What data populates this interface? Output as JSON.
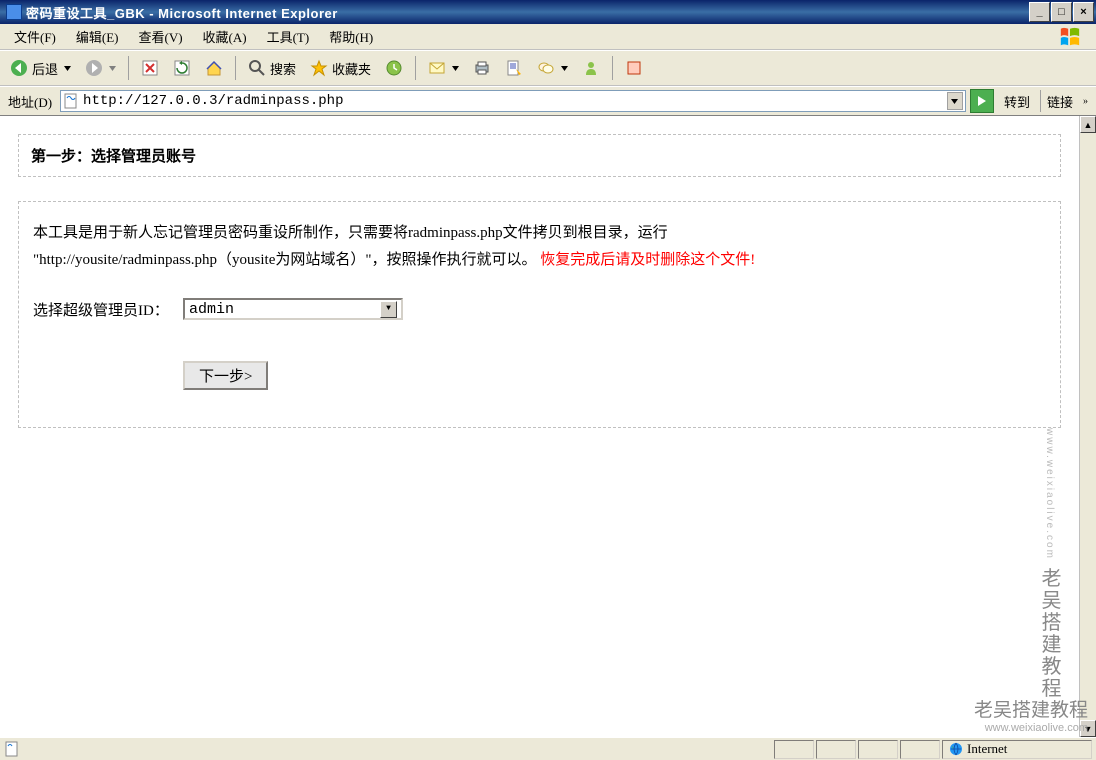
{
  "window": {
    "title": "密码重设工具_GBK - Microsoft Internet Explorer",
    "min": "_",
    "max": "□",
    "close": "×"
  },
  "menu": {
    "file": "文件(F)",
    "edit": "编辑(E)",
    "view": "查看(V)",
    "favorites": "收藏(A)",
    "tools": "工具(T)",
    "help": "帮助(H)"
  },
  "toolbar": {
    "back": "后退",
    "search": "搜索",
    "favorites": "收藏夹"
  },
  "addressbar": {
    "label": "地址(D)",
    "url": "http://127.0.0.3/radminpass.php",
    "go": "转到",
    "links": "链接"
  },
  "page": {
    "step_title": "第一步：选择管理员账号",
    "desc_prefix": "本工具是用于新人忘记管理员密码重设所制作，只需要将radminpass.php文件拷贝到根目录，运行",
    "desc_url": "\"http://yousite/radminpass.php（yousite为网站域名）\"，按照操作执行就可以。",
    "desc_warning": "恢复完成后请及时删除这个文件!",
    "form_label": "选择超级管理员ID：",
    "select_value": "admin",
    "next_button": "下一步>"
  },
  "status": {
    "zone": "Internet"
  },
  "watermark": {
    "vertical": "老吴搭建教程",
    "vertical_url": "www.weixiaolive.com",
    "bottom": "老吴搭建教程",
    "bottom_url": "www.weixiaolive.com"
  }
}
